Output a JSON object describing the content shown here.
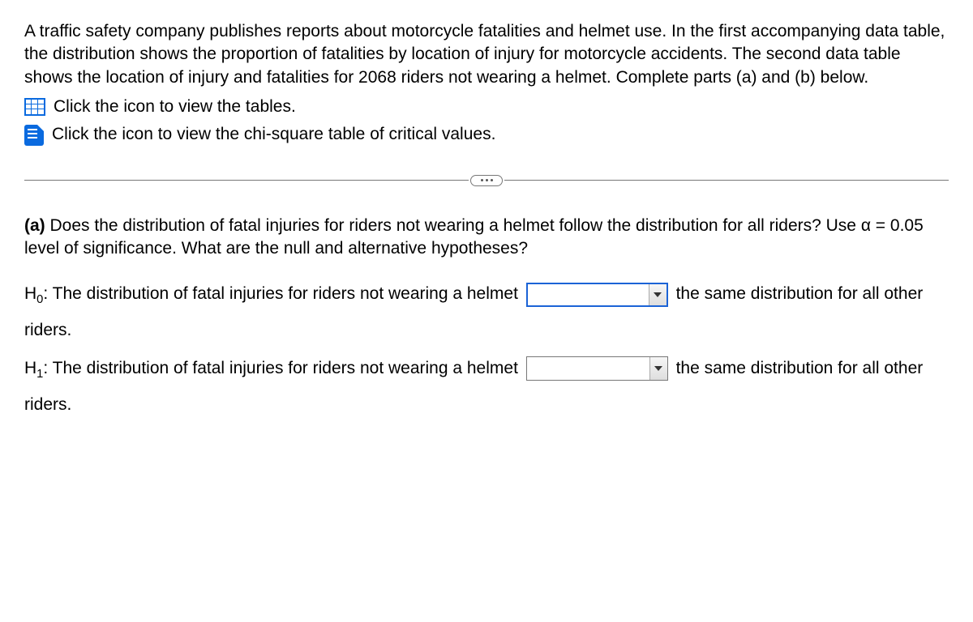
{
  "intro": "A traffic safety company publishes reports about motorcycle fatalities and helmet use. In the first accompanying data table, the distribution shows the proportion of fatalities by location of injury for motorcycle accidents. The second data table shows the location of injury and fatalities for 2068 riders not wearing a helmet. Complete parts (a) and (b) below.",
  "icons": {
    "tables_link": "Click the icon to view the tables.",
    "chi_link": "Click the icon to view the chi-square table of critical values."
  },
  "part_a": {
    "label": "(a)",
    "text": " Does the distribution of fatal injuries for riders not wearing a helmet follow the distribution for all riders? Use α = 0.05 level of significance. What are the null and alternative hypotheses?"
  },
  "h0": {
    "prefix": "H",
    "sub": "0",
    "before": ": The distribution of fatal injuries for riders not wearing a helmet ",
    "after": " the same distribution for all other riders."
  },
  "h1": {
    "prefix": "H",
    "sub": "1",
    "before": ": The distribution of fatal injuries for riders not wearing a helmet ",
    "after": " the same distribution for all other riders."
  }
}
